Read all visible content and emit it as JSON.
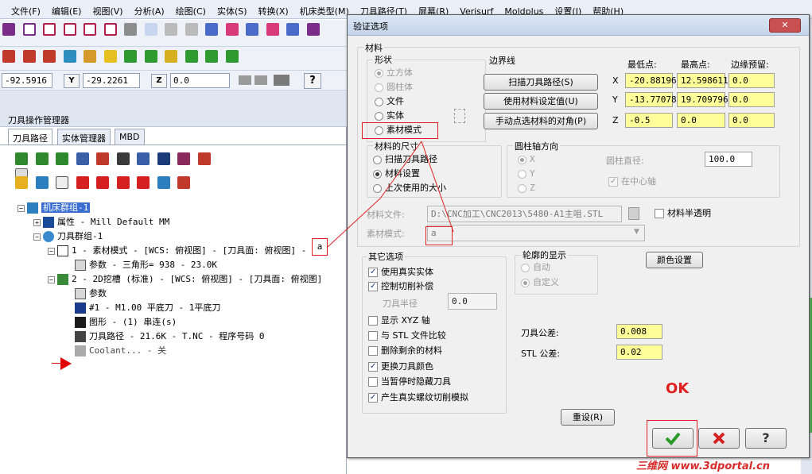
{
  "menu": [
    "文件(F)",
    "编辑(E)",
    "视图(V)",
    "分析(A)",
    "绘图(C)",
    "实体(S)",
    "转换(X)",
    "机床类型(M)",
    "刀具路径(T)",
    "屏幕(R)",
    "Verisurf",
    "Moldplus",
    "设置(I)",
    "帮助(H)"
  ],
  "coordbar": {
    "x_value": "-92.5916",
    "y_label": "Y",
    "y_value": "-29.2261",
    "z_label": "Z",
    "z_value": "0.0",
    "help_label": "?"
  },
  "left_panel": {
    "title": "刀具操作管理器",
    "tabs": [
      "刀具路径",
      "实体管理器",
      "MBD"
    ],
    "tree": [
      {
        "text": "机床群组-1",
        "icon": "machine-group-icon"
      },
      {
        "text": "属性 - Mill Default MM",
        "icon": "properties-icon"
      },
      {
        "text": "刀具群组-1",
        "icon": "toolgroup-icon"
      },
      {
        "text": "1 - 素材模式 - [WCS: 俯视图] - [刀具面: 俯视图] - ",
        "icon": "stock-model-icon"
      },
      {
        "text": "参数 - 三角形= 938 - 23.0K",
        "icon": "folder-icon"
      },
      {
        "text": "2 - 2D挖槽 (标准) - [WCS: 俯视图] - [刀具面: 俯视图]",
        "icon": "pocket-icon"
      },
      {
        "text": "参数",
        "icon": "folder-icon"
      },
      {
        "text": "#1 - M1.00 平底刀 - 1平底刀",
        "icon": "tool-icon"
      },
      {
        "text": "图形 - (1) 串连(s)",
        "icon": "geometry-icon"
      },
      {
        "text": "刀具路径 - 21.6K - T.NC - 程序号码 0",
        "icon": "toolpath-icon"
      },
      {
        "text": "Coolant... - 关",
        "icon": "coolant-icon"
      }
    ],
    "annotation_a": "a"
  },
  "dialog": {
    "title": "验证选项",
    "close": "✕",
    "material_group": "材料",
    "shape_group": "形状",
    "shapes": [
      {
        "label": "立方体",
        "on": true,
        "disabled": true
      },
      {
        "label": "圆柱体",
        "on": false,
        "disabled": true
      },
      {
        "label": "文件",
        "on": false,
        "disabled": false
      },
      {
        "label": "实体",
        "on": false,
        "disabled": false
      },
      {
        "label": "素材模式",
        "on": false,
        "disabled": false
      }
    ],
    "boundary_label": "边界线",
    "boundary_buttons": [
      "扫描刀具路径(S)",
      "使用材料设定值(U)",
      "手动点选材料的对角(P)"
    ],
    "col_min": "最低点:",
    "col_max": "最高点:",
    "col_margin": "边缘预留:",
    "axes": [
      "X",
      "Y",
      "Z"
    ],
    "min_values": [
      "-20.88196",
      "-13.77078",
      "-0.5"
    ],
    "max_values": [
      "12.598611",
      "19.709796",
      "0.0"
    ],
    "margin_values": [
      "0.0",
      "0.0",
      "0.0"
    ],
    "size_group": "材料的尺寸",
    "size_options": [
      {
        "label": "扫描刀具路径",
        "on": false
      },
      {
        "label": "材料设置",
        "on": true
      },
      {
        "label": "上次使用的大小",
        "on": false
      }
    ],
    "cyl_group": "圆柱轴方向",
    "cyl_axes": [
      "X",
      "Y",
      "Z"
    ],
    "cyl_diam_label": "圆柱直径:",
    "cyl_diam_value": "100.0",
    "cyl_center_label": "在中心轴",
    "file_label": "材料文件:",
    "file_value": "D:\\CNC加工\\CNC2013\\5480-A1主咀.STL",
    "semi_transparent_label": "材料半透明",
    "stock_mode_label": "素材模式:",
    "stock_mode_value": "a",
    "other_group": "其它选项",
    "other_options": [
      {
        "label": "使用真实实体",
        "on": true
      },
      {
        "label": "控制切削补偿",
        "on": true
      }
    ],
    "tool_radius_label": "刀具半径",
    "tool_radius_value": "0.0",
    "other_options2": [
      {
        "label": "显示 XYZ 轴",
        "on": false
      },
      {
        "label": "与 STL 文件比较",
        "on": false
      },
      {
        "label": "删除剩余的材料",
        "on": false
      },
      {
        "label": "更换刀具颜色",
        "on": true
      },
      {
        "label": "当暂停时隐藏刀具",
        "on": false
      },
      {
        "label": "产生真实螺纹切削模拟",
        "on": true
      }
    ],
    "contour_group": "轮廓的显示",
    "contour_options": [
      {
        "label": "自动",
        "on": false
      },
      {
        "label": "自定义",
        "on": true
      }
    ],
    "color_button": "颜色设置",
    "tool_tol_label": "刀具公差:",
    "tool_tol_value": "0.008",
    "stl_tol_label": "STL 公差:",
    "stl_tol_value": "0.02",
    "reset_button": "重设(R)",
    "ok_annotation": "OK",
    "help_label": "?"
  },
  "watermark": "三维网 www.3dportal.cn",
  "colors": {
    "accent_red": "#e02020",
    "field_yellow": "#ffff99",
    "ok_green": "#2a9a2a",
    "cancel_red": "#d42020"
  }
}
